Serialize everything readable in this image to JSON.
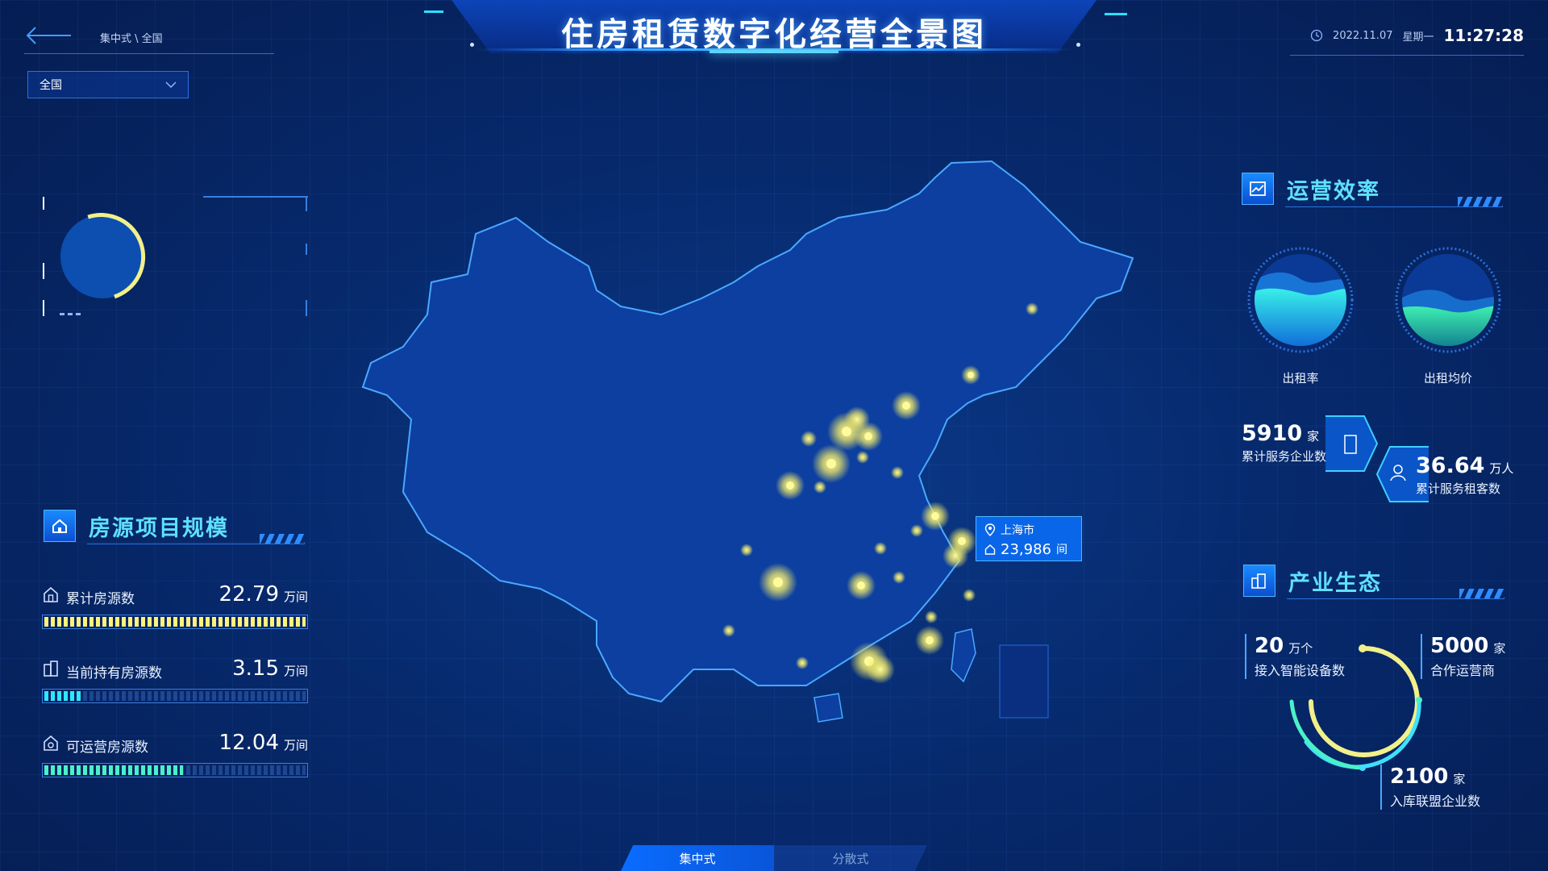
{
  "header": {
    "title": "住房租赁数字化经营全景图",
    "breadcrumb": "集中式 \\ 全国",
    "date": "2022.11.07",
    "weekday": "星期一",
    "time": "11:27:28"
  },
  "region_select": {
    "value": "全国"
  },
  "housing_scale": {
    "title": "房源项目规模",
    "stats": [
      {
        "label": "累计房源数",
        "value": "22.79",
        "unit": "万间",
        "fill_fraction": 1.0,
        "color": "#fff27a"
      },
      {
        "label": "当前持有房源数",
        "value": "3.15",
        "unit": "万间",
        "fill_fraction": 0.14,
        "color": "#2fe6ff"
      },
      {
        "label": "可运营房源数",
        "value": "12.04",
        "unit": "万间",
        "fill_fraction": 0.53,
        "color": "#4cf0c8"
      }
    ]
  },
  "map": {
    "tooltip": {
      "city": "上海市",
      "value": "23,986",
      "unit": "间"
    }
  },
  "operating_efficiency": {
    "title": "运营效率",
    "gauges": [
      {
        "label": "出租率"
      },
      {
        "label": "出租均价"
      }
    ],
    "kpis": [
      {
        "value": "5910",
        "unit": "家",
        "label": "累计服务企业数"
      },
      {
        "value": "36.64",
        "unit": "万人",
        "label": "累计服务租客数"
      }
    ]
  },
  "industry_ecology": {
    "title": "产业生态",
    "items": [
      {
        "value": "20",
        "unit": "万个",
        "label": "接入智能设备数"
      },
      {
        "value": "5000",
        "unit": "家",
        "label": "合作运营商"
      },
      {
        "value": "2100",
        "unit": "家",
        "label": "入库联盟企业数"
      }
    ]
  },
  "tabs": {
    "active": "集中式",
    "inactive": "分散式"
  },
  "colors": {
    "accent": "#5fe0ff",
    "primary": "#0a66e8",
    "gauge_yellow": "#f2f08a"
  }
}
